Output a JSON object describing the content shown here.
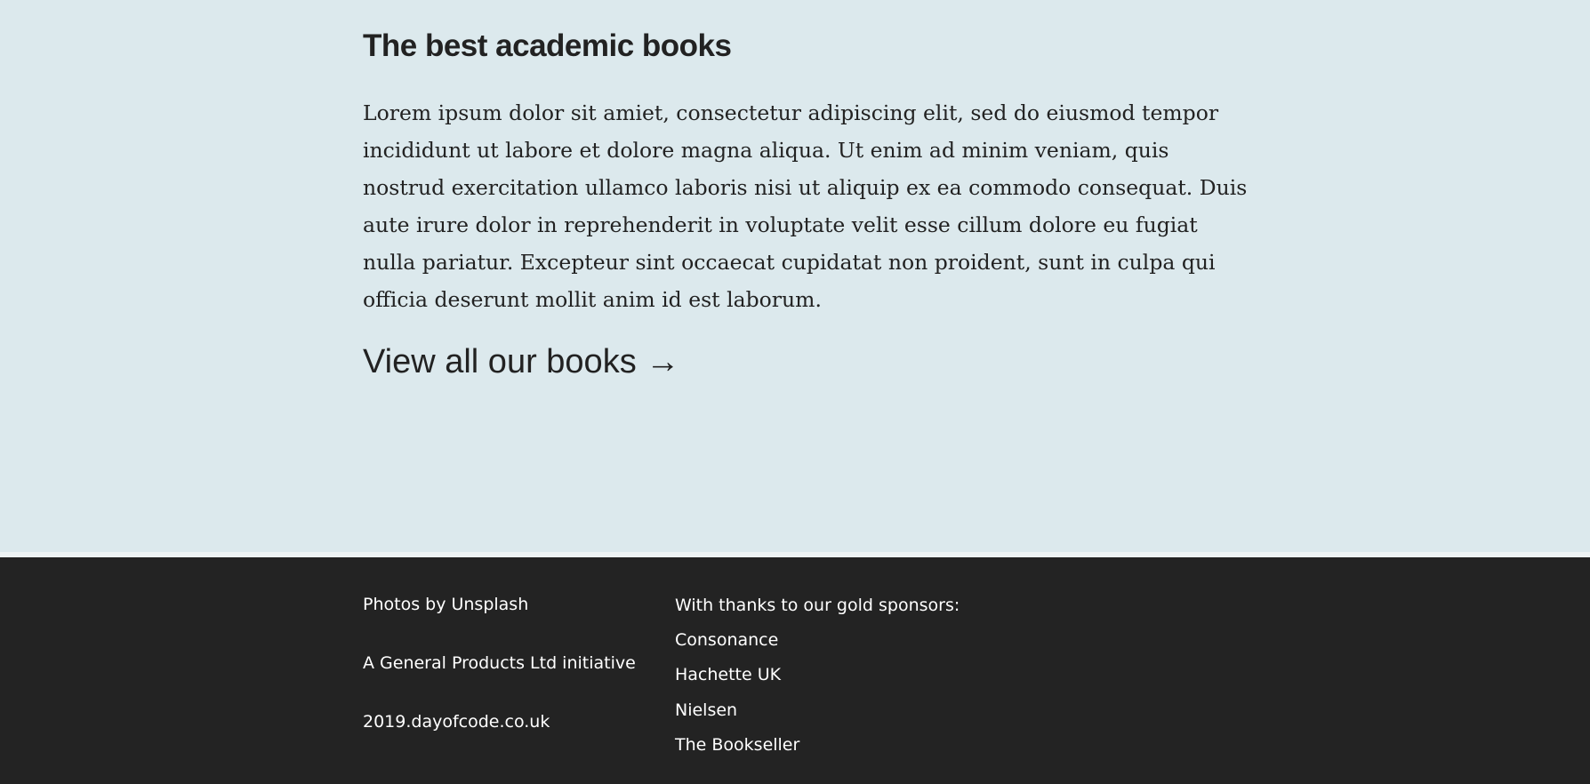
{
  "main": {
    "heading": "The best academic books",
    "paragraph": "Lorem ipsum dolor sit amiet, consectetur adipiscing elit, sed do eiusmod tempor incididunt ut labore et dolore magna aliqua. Ut enim ad minim veniam, quis nostrud exercitation ullamco laboris nisi ut aliquip ex ea commodo consequat. Duis aute irure dolor in reprehenderit in voluptate velit esse cillum dolore eu fugiat nulla pariatur. Excepteur sint occaecat cupidatat non proident, sunt in culpa qui officia deserunt mollit anim id est laborum.",
    "view_all_link": "View all our books →"
  },
  "footer": {
    "photos_credit": "Photos by Unsplash",
    "initiative": "A General Products Ltd initiative",
    "site_url": "2019.dayofcode.co.uk",
    "sponsors_heading": "With thanks to our gold sponsors:",
    "sponsors": [
      "Consonance",
      "Hachette UK",
      "Nielsen",
      "The Bookseller"
    ]
  },
  "colors": {
    "background": "#dce9ed",
    "footer_background": "#232323",
    "text": "#222222",
    "footer_text": "#ffffff"
  }
}
